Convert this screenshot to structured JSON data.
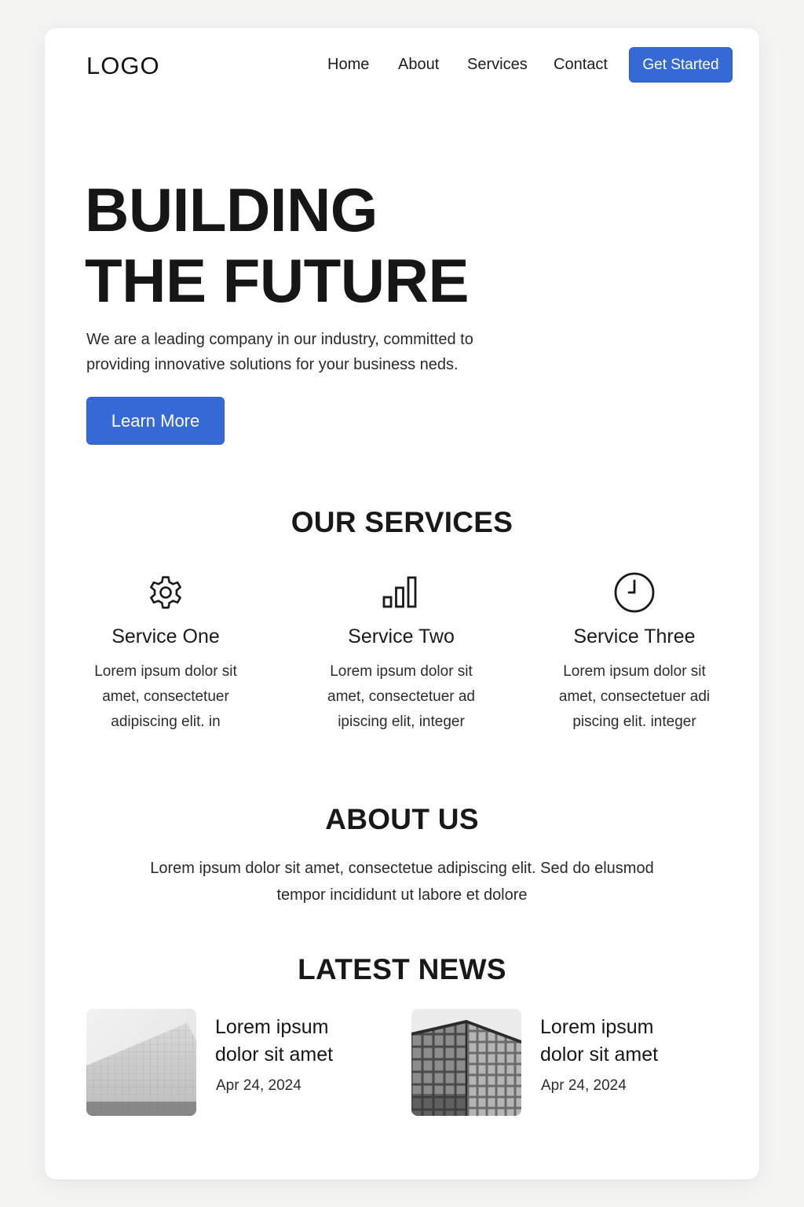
{
  "header": {
    "logo": "LOGO",
    "nav": [
      {
        "label": "Home"
      },
      {
        "label": "About"
      },
      {
        "label": "Services"
      },
      {
        "label": "Contact"
      }
    ],
    "cta_label": "Get Started"
  },
  "hero": {
    "title_line1": "BUILDING",
    "title_line2": "THE FUTURE",
    "description": "We are a leading company in our industry, committed to providing innovative solutions for your business neds.",
    "button_label": "Learn More"
  },
  "services": {
    "title": "OUR SERVICES",
    "items": [
      {
        "icon": "gear-icon",
        "title": "Service One",
        "text": "Lorem ipsum dolor sit amet, consectetuer adipiscing elit. in"
      },
      {
        "icon": "bar-chart-icon",
        "title": "Service Two",
        "text": "Lorem ipsum dolor sit amet, consectetuer ad ipiscing elit, integer"
      },
      {
        "icon": "clock-icon",
        "title": "Service Three",
        "text": "Lorem ipsum dolor sit amet, consectetuer adi piscing elit. integer"
      }
    ]
  },
  "about": {
    "title": "ABOUT US",
    "text": "Lorem ipsum  dolor sit amet, consectetue adipiscing elit. Sed do elusmod tempor incididunt ut labore et dolore"
  },
  "news": {
    "title": "LATEST NEWS",
    "items": [
      {
        "headline": "Lorem ipsum dolor sit amet",
        "date": "Apr 24, 2024"
      },
      {
        "headline": "Lorem ipsum dolor sit amet",
        "date": "Apr 24, 2024"
      }
    ]
  },
  "colors": {
    "accent": "#3569d6",
    "text": "#1a1a1a",
    "background": "#f4f4f3",
    "card": "#ffffff"
  }
}
